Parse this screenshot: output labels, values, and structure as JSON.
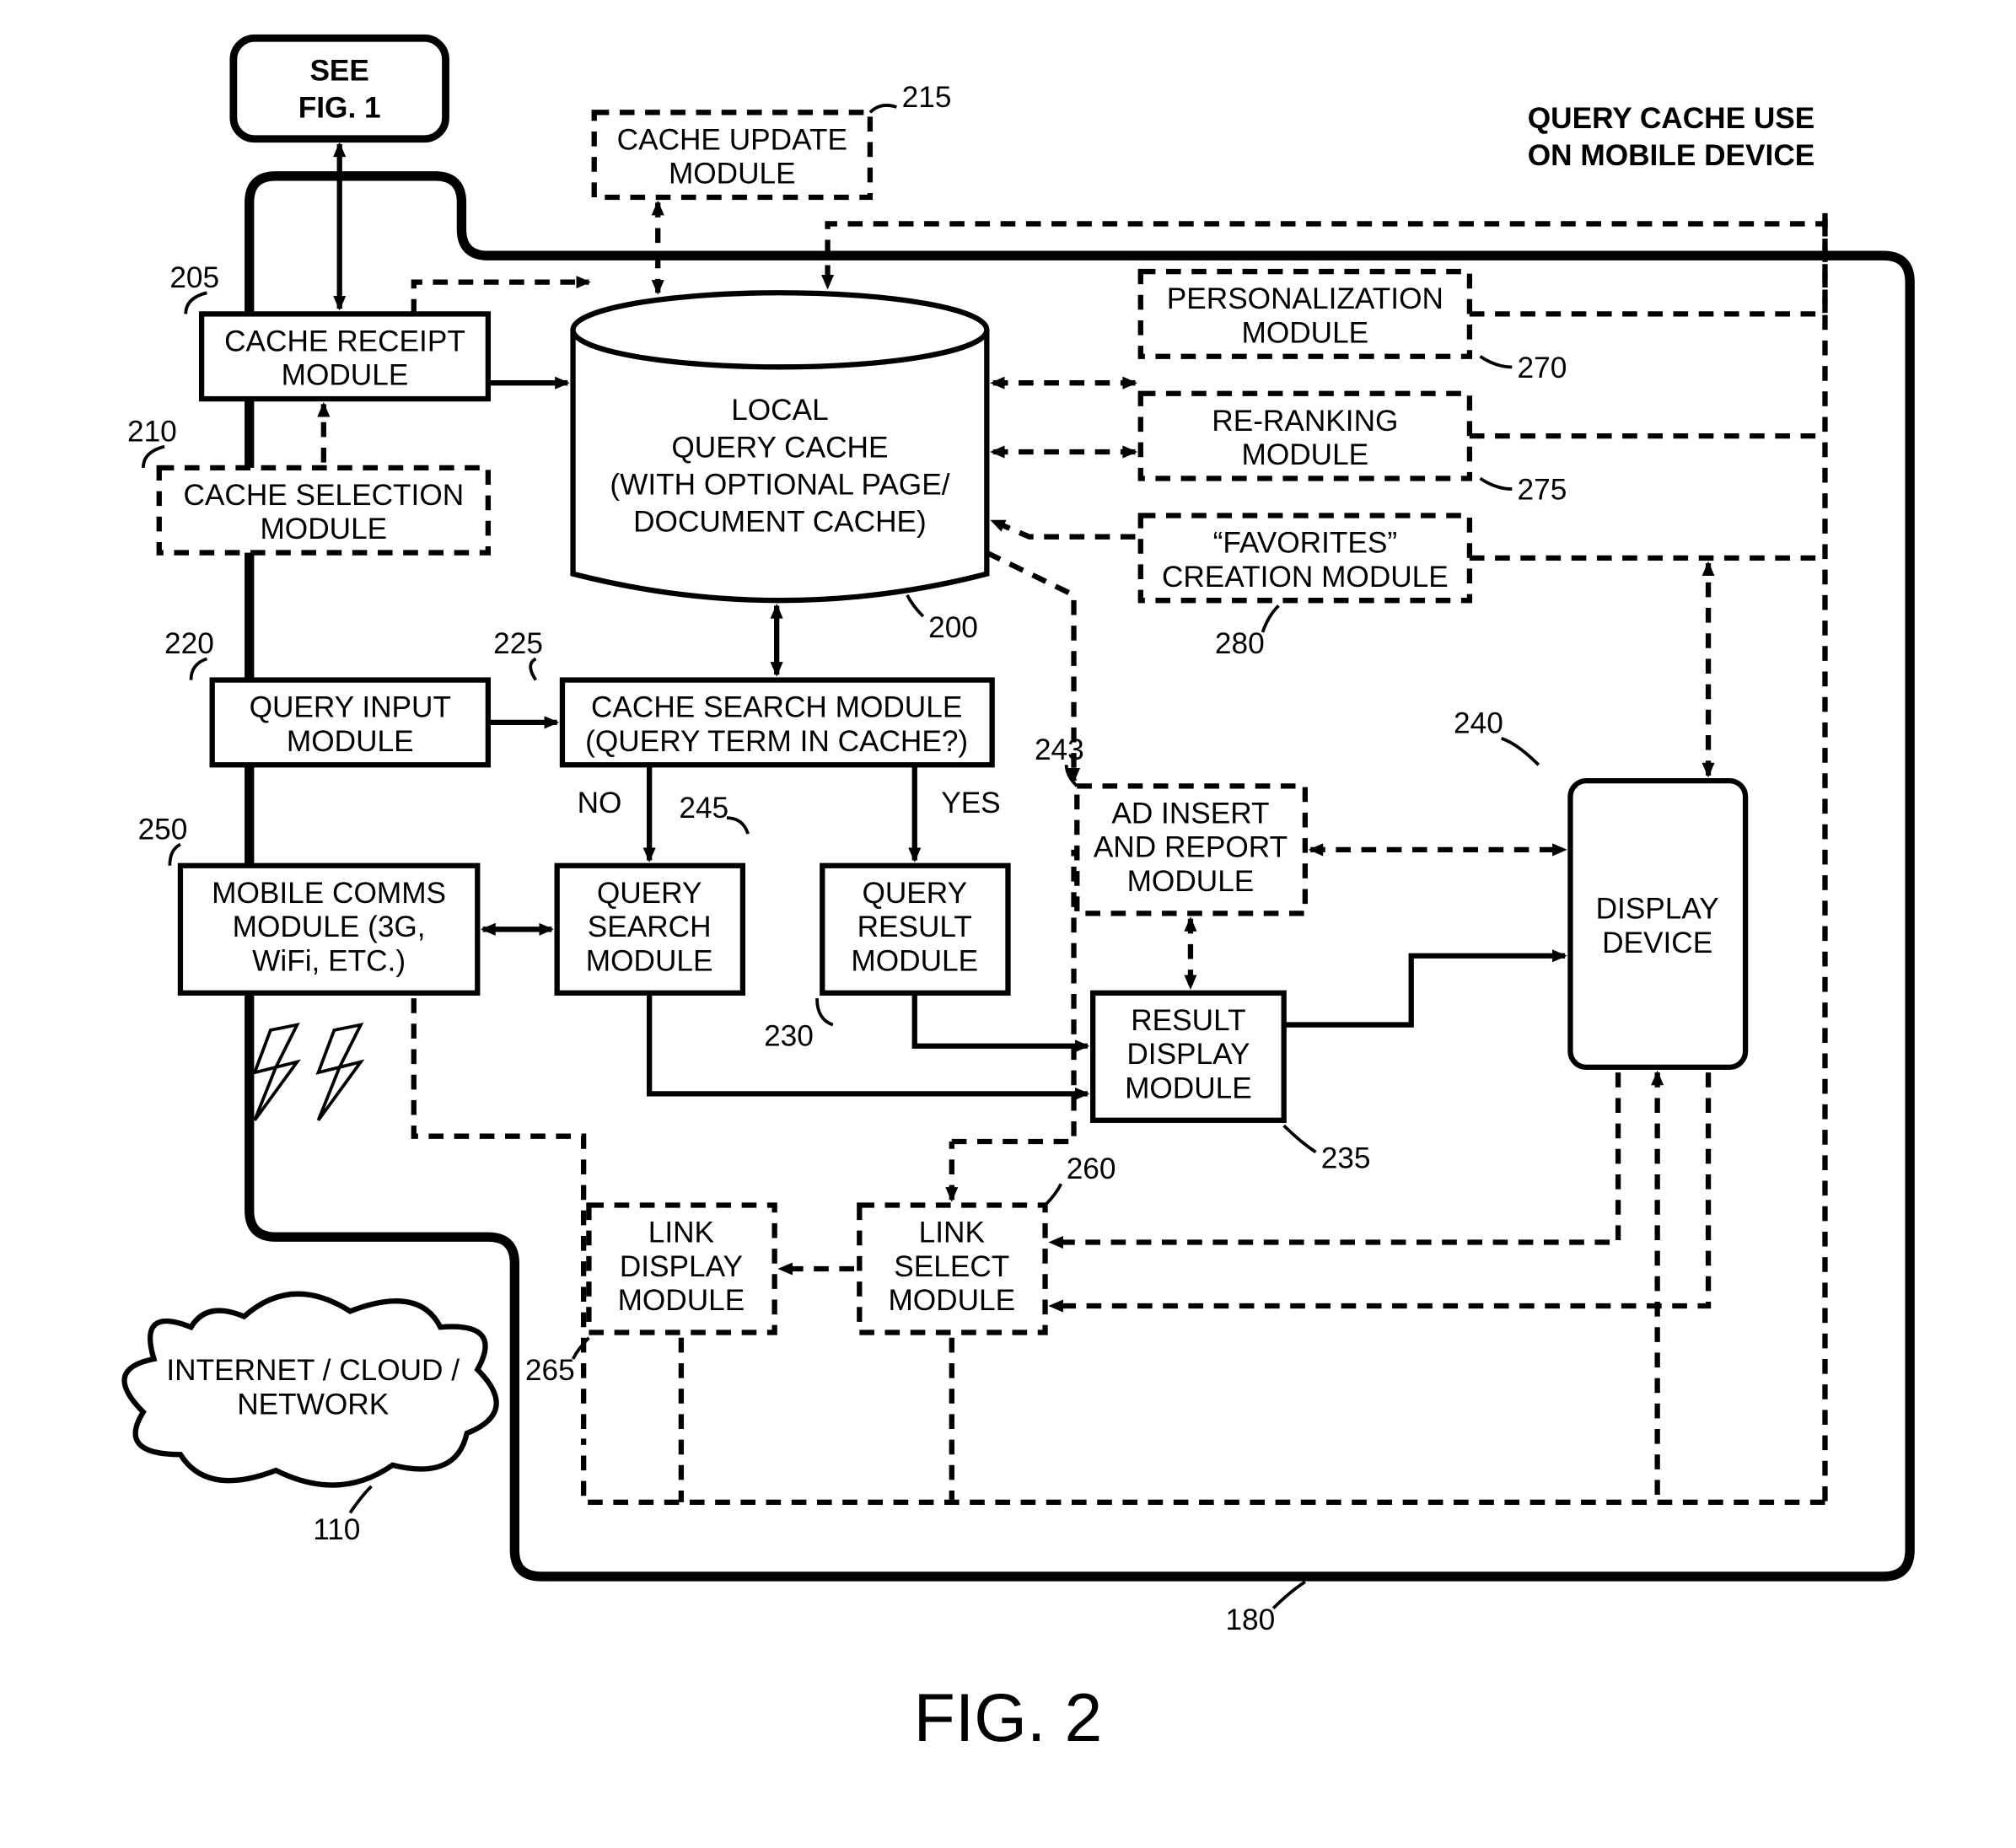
{
  "figure_number": "FIG. 2",
  "title_l1": "QUERY CACHE USE",
  "title_l2": "ON MOBILE DEVICE",
  "see_fig1_l1": "SEE",
  "see_fig1_l2": "FIG. 1",
  "cache_receipt_l1": "CACHE RECEIPT",
  "cache_receipt_l2": "MODULE",
  "cache_selection_l1": "CACHE SELECTION",
  "cache_selection_l2": "MODULE",
  "cache_update_l1": "CACHE UPDATE",
  "cache_update_l2": "MODULE",
  "query_cache_l1": "LOCAL",
  "query_cache_l2": "QUERY CACHE",
  "query_cache_l3": "(WITH OPTIONAL PAGE/",
  "query_cache_l4": "DOCUMENT CACHE)",
  "personalization_l1": "PERSONALIZATION",
  "personalization_l2": "MODULE",
  "reranking_l1": "RE-RANKING",
  "reranking_l2": "MODULE",
  "favorites_l1": "“FAVORITES”",
  "favorites_l2": "CREATION MODULE",
  "query_input_l1": "QUERY INPUT",
  "query_input_l2": "MODULE",
  "cache_search_l1": "CACHE SEARCH MODULE",
  "cache_search_l2": "(QUERY TERM IN CACHE?)",
  "no_label": "NO",
  "yes_label": "YES",
  "mobile_comms_l1": "MOBILE COMMS",
  "mobile_comms_l2": "MODULE (3G,",
  "mobile_comms_l3": "WiFi, ETC.)",
  "query_search_l1": "QUERY",
  "query_search_l2": "SEARCH",
  "query_search_l3": "MODULE",
  "query_result_l1": "QUERY",
  "query_result_l2": "RESULT",
  "query_result_l3": "MODULE",
  "ad_insert_l1": "AD INSERT",
  "ad_insert_l2": "AND REPORT",
  "ad_insert_l3": "MODULE",
  "display_device_l1": "DISPLAY",
  "display_device_l2": "DEVICE",
  "result_display_l1": "RESULT",
  "result_display_l2": "DISPLAY",
  "result_display_l3": "MODULE",
  "link_display_l1": "LINK",
  "link_display_l2": "DISPLAY",
  "link_display_l3": "MODULE",
  "link_select_l1": "LINK",
  "link_select_l2": "SELECT",
  "link_select_l3": "MODULE",
  "internet_l1": "INTERNET / CLOUD /",
  "internet_l2": "NETWORK",
  "ref_110": "110",
  "ref_180": "180",
  "ref_200": "200",
  "ref_205": "205",
  "ref_210": "210",
  "ref_215": "215",
  "ref_220": "220",
  "ref_225": "225",
  "ref_230": "230",
  "ref_235": "235",
  "ref_240": "240",
  "ref_243": "243",
  "ref_245": "245",
  "ref_250": "250",
  "ref_260": "260",
  "ref_265": "265",
  "ref_270": "270",
  "ref_275": "275",
  "ref_280": "280"
}
